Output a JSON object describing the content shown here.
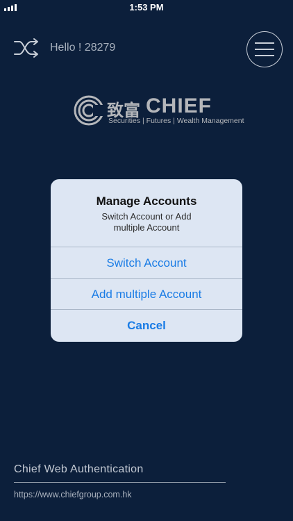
{
  "status_bar": {
    "time": "1:53 PM"
  },
  "header": {
    "greeting": "Hello ! 28279",
    "switch_icon": "shuffle-icon",
    "menu_icon": "hamburger-menu-icon"
  },
  "logo": {
    "chinese_name": "致富",
    "english_name": "CHIEF",
    "tagline": "Securities | Futures | Wealth Management"
  },
  "dialog": {
    "title": "Manage Accounts",
    "message": "Switch Account or Add multiple Account",
    "actions": [
      {
        "label": "Switch Account"
      },
      {
        "label": "Add multiple Account"
      }
    ],
    "cancel_label": "Cancel"
  },
  "footer": {
    "title": "Chief Web Authentication",
    "url": "https://www.chiefgroup.com.hk"
  },
  "colors": {
    "background": "#0c1f3b",
    "sheet": "#dde6f3",
    "action": "#1a7ce5"
  }
}
